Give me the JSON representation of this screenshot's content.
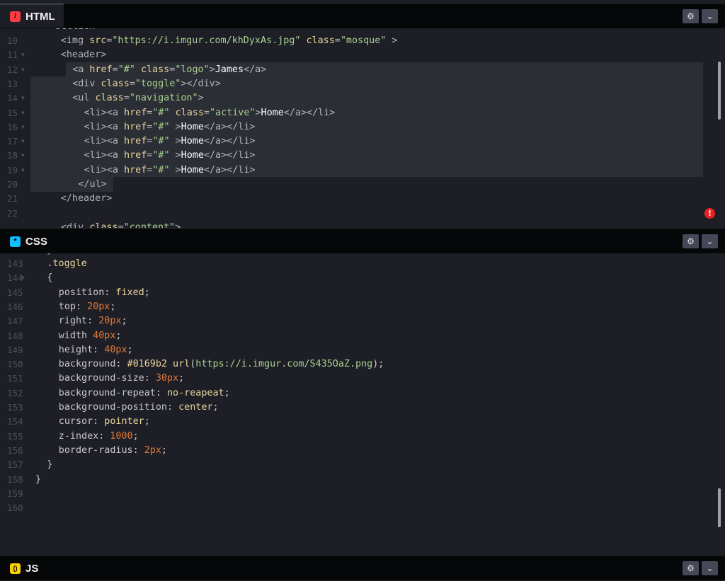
{
  "html_panel": {
    "tab_label": "HTML",
    "icon": "html-slash-icon",
    "icon_glyph": "/",
    "accent": "#ff3c41",
    "settings_glyph": "⚙",
    "collapse_glyph": "⌄",
    "error_glyph": "!",
    "lines": [
      {
        "n": "10",
        "fold": false,
        "indent": 4,
        "tokens": [
          {
            "c": "t-tag",
            "t": "<img "
          },
          {
            "c": "t-attr",
            "t": "src"
          },
          {
            "c": "t-tag",
            "t": "="
          },
          {
            "c": "t-str",
            "t": "\"https://i.imgur.com/khDyxAs.jpg\""
          },
          {
            "c": "t-tag",
            "t": " "
          },
          {
            "c": "t-attr",
            "t": "class"
          },
          {
            "c": "t-tag",
            "t": "="
          },
          {
            "c": "t-str",
            "t": "\"mosque\""
          },
          {
            "c": "t-tag",
            "t": " >"
          }
        ]
      },
      {
        "n": "11",
        "fold": true,
        "indent": 4,
        "tokens": [
          {
            "c": "t-tag",
            "t": "<header>"
          }
        ]
      },
      {
        "n": "12",
        "fold": true,
        "indent": 6,
        "tokens": [
          {
            "c": "t-tag",
            "t": "<a "
          },
          {
            "c": "t-attr",
            "t": "href"
          },
          {
            "c": "t-tag",
            "t": "="
          },
          {
            "c": "t-str",
            "t": "\"#\""
          },
          {
            "c": "t-tag",
            "t": " "
          },
          {
            "c": "t-attr",
            "t": "class"
          },
          {
            "c": "t-tag",
            "t": "="
          },
          {
            "c": "t-str",
            "t": "\"logo\""
          },
          {
            "c": "t-tag",
            "t": ">"
          },
          {
            "c": "t-text",
            "t": "James"
          },
          {
            "c": "t-tag",
            "t": "</a>"
          }
        ]
      },
      {
        "n": "13",
        "fold": false,
        "indent": 6,
        "tokens": [
          {
            "c": "t-tag",
            "t": "<div "
          },
          {
            "c": "t-attr",
            "t": "class"
          },
          {
            "c": "t-tag",
            "t": "="
          },
          {
            "c": "t-str",
            "t": "\"toggle\""
          },
          {
            "c": "t-tag",
            "t": "></div>"
          }
        ]
      },
      {
        "n": "14",
        "fold": true,
        "indent": 6,
        "tokens": [
          {
            "c": "t-tag",
            "t": "<ul "
          },
          {
            "c": "t-attr",
            "t": "class"
          },
          {
            "c": "t-tag",
            "t": "="
          },
          {
            "c": "t-str",
            "t": "\"navigation\""
          },
          {
            "c": "t-tag",
            "t": ">"
          }
        ]
      },
      {
        "n": "15",
        "fold": true,
        "indent": 8,
        "tokens": [
          {
            "c": "t-tag",
            "t": "<li><a "
          },
          {
            "c": "t-attr",
            "t": "href"
          },
          {
            "c": "t-tag",
            "t": "="
          },
          {
            "c": "t-str",
            "t": "\"#\""
          },
          {
            "c": "t-tag",
            "t": " "
          },
          {
            "c": "t-attr",
            "t": "class"
          },
          {
            "c": "t-tag",
            "t": "="
          },
          {
            "c": "t-str",
            "t": "\"active\""
          },
          {
            "c": "t-tag",
            "t": ">"
          },
          {
            "c": "t-text",
            "t": "Home"
          },
          {
            "c": "t-tag",
            "t": "</a></li>"
          }
        ]
      },
      {
        "n": "16",
        "fold": true,
        "indent": 8,
        "tokens": [
          {
            "c": "t-tag",
            "t": "<li><a "
          },
          {
            "c": "t-attr",
            "t": "href"
          },
          {
            "c": "t-tag",
            "t": "="
          },
          {
            "c": "t-str",
            "t": "\"#\""
          },
          {
            "c": "t-tag",
            "t": " >"
          },
          {
            "c": "t-text",
            "t": "Home"
          },
          {
            "c": "t-tag",
            "t": "</a></li>"
          }
        ]
      },
      {
        "n": "17",
        "fold": true,
        "indent": 8,
        "tokens": [
          {
            "c": "t-tag",
            "t": "<li><a "
          },
          {
            "c": "t-attr",
            "t": "href"
          },
          {
            "c": "t-tag",
            "t": "="
          },
          {
            "c": "t-str",
            "t": "\"#\""
          },
          {
            "c": "t-tag",
            "t": " >"
          },
          {
            "c": "t-text",
            "t": "Home"
          },
          {
            "c": "t-tag",
            "t": "</a></li>"
          }
        ]
      },
      {
        "n": "18",
        "fold": true,
        "indent": 8,
        "tokens": [
          {
            "c": "t-tag",
            "t": "<li><a "
          },
          {
            "c": "t-attr",
            "t": "href"
          },
          {
            "c": "t-tag",
            "t": "="
          },
          {
            "c": "t-str",
            "t": "\"#\""
          },
          {
            "c": "t-tag",
            "t": " >"
          },
          {
            "c": "t-text",
            "t": "Home"
          },
          {
            "c": "t-tag",
            "t": "</a></li>"
          }
        ]
      },
      {
        "n": "19",
        "fold": true,
        "indent": 8,
        "tokens": [
          {
            "c": "t-tag",
            "t": "<li><a "
          },
          {
            "c": "t-attr",
            "t": "href"
          },
          {
            "c": "t-tag",
            "t": "="
          },
          {
            "c": "t-str",
            "t": "\"#\""
          },
          {
            "c": "t-tag",
            "t": " >"
          },
          {
            "c": "t-text",
            "t": "Home"
          },
          {
            "c": "t-tag",
            "t": "</a></li>"
          }
        ]
      },
      {
        "n": "20",
        "fold": false,
        "indent": 7,
        "tokens": [
          {
            "c": "t-tag",
            "t": "</ul>"
          }
        ]
      },
      {
        "n": "21",
        "fold": false,
        "indent": 4,
        "tokens": [
          {
            "c": "t-tag",
            "t": "</header>"
          }
        ]
      },
      {
        "n": "22",
        "fold": false,
        "indent": 0,
        "tokens": []
      }
    ]
  },
  "css_panel": {
    "tab_label": "CSS",
    "icon": "css-asterisk-icon",
    "icon_glyph": "*",
    "accent": "#0ebeff",
    "settings_glyph": "⚙",
    "collapse_glyph": "⌄",
    "lines": [
      {
        "n": "143",
        "fold": false,
        "indent": 2,
        "tokens": [
          {
            "c": "t-sel",
            "t": ".toggle"
          }
        ]
      },
      {
        "n": "144",
        "fold": true,
        "indent": 2,
        "tokens": [
          {
            "c": "t-punct",
            "t": "{"
          }
        ]
      },
      {
        "n": "145",
        "fold": false,
        "indent": 4,
        "tokens": [
          {
            "c": "t-prop",
            "t": "position"
          },
          {
            "c": "t-punct",
            "t": ": "
          },
          {
            "c": "t-val",
            "t": "fixed"
          },
          {
            "c": "t-punct",
            "t": ";"
          }
        ]
      },
      {
        "n": "146",
        "fold": false,
        "indent": 4,
        "tokens": [
          {
            "c": "t-prop",
            "t": "top"
          },
          {
            "c": "t-punct",
            "t": ": "
          },
          {
            "c": "t-num",
            "t": "20px"
          },
          {
            "c": "t-punct",
            "t": ";"
          }
        ]
      },
      {
        "n": "147",
        "fold": false,
        "indent": 4,
        "tokens": [
          {
            "c": "t-prop",
            "t": "right"
          },
          {
            "c": "t-punct",
            "t": ": "
          },
          {
            "c": "t-num",
            "t": "20px"
          },
          {
            "c": "t-punct",
            "t": ";"
          }
        ]
      },
      {
        "n": "148",
        "fold": false,
        "indent": 4,
        "tokens": [
          {
            "c": "t-prop",
            "t": "width"
          },
          {
            "c": "t-punct",
            "t": " "
          },
          {
            "c": "t-num",
            "t": "40px"
          },
          {
            "c": "t-punct",
            "t": ";"
          }
        ]
      },
      {
        "n": "149",
        "fold": false,
        "indent": 4,
        "tokens": [
          {
            "c": "t-prop",
            "t": "height"
          },
          {
            "c": "t-punct",
            "t": ": "
          },
          {
            "c": "t-num",
            "t": "40px"
          },
          {
            "c": "t-punct",
            "t": ";"
          }
        ]
      },
      {
        "n": "150",
        "fold": false,
        "indent": 4,
        "tokens": [
          {
            "c": "t-prop",
            "t": "background"
          },
          {
            "c": "t-punct",
            "t": ": "
          },
          {
            "c": "t-val",
            "t": "#0169b2"
          },
          {
            "c": "t-punct",
            "t": " "
          },
          {
            "c": "t-val",
            "t": "url"
          },
          {
            "c": "t-punct",
            "t": "("
          },
          {
            "c": "t-url",
            "t": "https://i.imgur.com/S435OaZ.png"
          },
          {
            "c": "t-punct",
            "t": ");"
          }
        ]
      },
      {
        "n": "151",
        "fold": false,
        "indent": 4,
        "tokens": [
          {
            "c": "t-prop",
            "t": "background-size"
          },
          {
            "c": "t-punct",
            "t": ": "
          },
          {
            "c": "t-num",
            "t": "30px"
          },
          {
            "c": "t-punct",
            "t": ";"
          }
        ]
      },
      {
        "n": "152",
        "fold": false,
        "indent": 4,
        "tokens": [
          {
            "c": "t-prop",
            "t": "background-repeat"
          },
          {
            "c": "t-punct",
            "t": ": "
          },
          {
            "c": "t-val",
            "t": "no-reapeat"
          },
          {
            "c": "t-punct",
            "t": ";"
          }
        ]
      },
      {
        "n": "153",
        "fold": false,
        "indent": 4,
        "tokens": [
          {
            "c": "t-prop",
            "t": "background-position"
          },
          {
            "c": "t-punct",
            "t": ": "
          },
          {
            "c": "t-val",
            "t": "center"
          },
          {
            "c": "t-punct",
            "t": ";"
          }
        ]
      },
      {
        "n": "154",
        "fold": false,
        "indent": 4,
        "tokens": [
          {
            "c": "t-prop",
            "t": "cursor"
          },
          {
            "c": "t-punct",
            "t": ": "
          },
          {
            "c": "t-val",
            "t": "pointer"
          },
          {
            "c": "t-punct",
            "t": ";"
          }
        ]
      },
      {
        "n": "155",
        "fold": false,
        "indent": 4,
        "tokens": [
          {
            "c": "t-prop",
            "t": "z-index"
          },
          {
            "c": "t-punct",
            "t": ": "
          },
          {
            "c": "t-num",
            "t": "1000"
          },
          {
            "c": "t-punct",
            "t": ";"
          }
        ]
      },
      {
        "n": "156",
        "fold": false,
        "indent": 4,
        "tokens": [
          {
            "c": "t-prop",
            "t": "border-radius"
          },
          {
            "c": "t-punct",
            "t": ": "
          },
          {
            "c": "t-num",
            "t": "2px"
          },
          {
            "c": "t-punct",
            "t": ";"
          }
        ]
      },
      {
        "n": "157",
        "fold": false,
        "indent": 2,
        "tokens": [
          {
            "c": "t-punct",
            "t": "}"
          }
        ]
      },
      {
        "n": "158",
        "fold": false,
        "indent": 0,
        "tokens": [
          {
            "c": "t-punct",
            "t": "}"
          }
        ]
      },
      {
        "n": "159",
        "fold": false,
        "indent": 0,
        "tokens": []
      },
      {
        "n": "160",
        "fold": false,
        "indent": 0,
        "tokens": []
      }
    ]
  },
  "js_panel": {
    "tab_label": "JS",
    "icon": "js-braces-icon",
    "icon_glyph": "()",
    "accent": "#fcd000",
    "settings_glyph": "⚙",
    "collapse_glyph": "⌄"
  }
}
